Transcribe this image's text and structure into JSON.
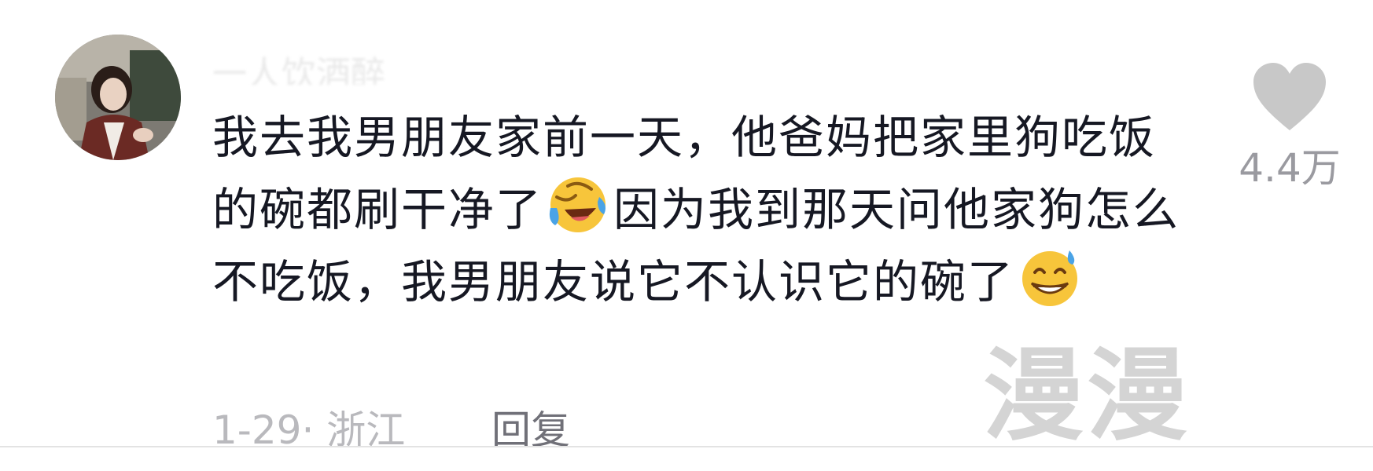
{
  "comment": {
    "username": "一人饮酒醉",
    "body": {
      "part1": "我去我男朋友家前一天，他爸妈把家里狗吃饭的碗都刷干净了",
      "emoji1": "laughing-tears-emoji",
      "part2": "因为我到那天问他家狗怎么不吃饭，我男朋友说它不认识它的碗了",
      "emoji2": "sweat-grin-emoji"
    },
    "date": "1-29",
    "separator": "·",
    "location": "浙江",
    "reply_label": "回复",
    "like_count": "4.4万",
    "like_icon": "heart-icon"
  },
  "watermark": "漫漫",
  "colors": {
    "text": "#161823",
    "meta": "#b9b9bd",
    "reply": "#707078",
    "like_icon": "#c8c8c8",
    "watermark": "#d4d4d4"
  }
}
